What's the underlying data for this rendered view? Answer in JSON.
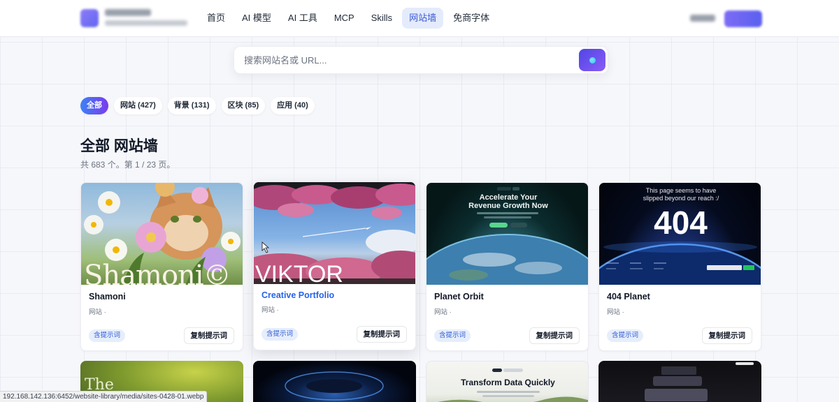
{
  "nav": {
    "items": [
      {
        "label": "首页"
      },
      {
        "label": "AI 模型"
      },
      {
        "label": "AI 工具"
      },
      {
        "label": "MCP"
      },
      {
        "label": "Skills"
      },
      {
        "label": "网站墙",
        "active": true
      },
      {
        "label": "免商字体"
      }
    ]
  },
  "search": {
    "placeholder": "搜索网站名或 URL..."
  },
  "filters": [
    {
      "label": "全部",
      "active": true
    },
    {
      "label": "网站 (427)"
    },
    {
      "label": "背景 (131)"
    },
    {
      "label": "区块 (85)"
    },
    {
      "label": "应用 (40)"
    }
  ],
  "page": {
    "title": "全部 网站墙",
    "subtitle": "共 683 个。第 1 / 23 页。"
  },
  "cards": [
    {
      "title": "Shamoni",
      "meta": "网站 ·",
      "tag": "含提示词",
      "copy": "复制提示词",
      "thumb_text": "Shamoni©"
    },
    {
      "title": "Creative Portfolio",
      "meta": "网站 ·",
      "tag": "含提示词",
      "copy": "复制提示词",
      "thumb_text": "VIKTOR"
    },
    {
      "title": "Planet Orbit",
      "meta": "网站 ·",
      "tag": "含提示词",
      "copy": "复制提示词",
      "thumb_text": "Accelerate Your Revenue Growth Now"
    },
    {
      "title": "404 Planet",
      "meta": "网站 ·",
      "tag": "含提示词",
      "copy": "复制提示词",
      "thumb_text": "This page seems to have slipped beyond our reach :/",
      "thumb_number": "404"
    }
  ],
  "row2": [
    {
      "thumb_text": "The"
    },
    {
      "thumb_text": ""
    },
    {
      "thumb_text": "Transform Data Quickly"
    },
    {
      "thumb_text": ""
    }
  ],
  "status_url": "192.168.142.136:6452/website-library/media/sites-0428-01.webp",
  "colors": {
    "accent": "#4f46e5",
    "active_nav_bg": "#e4ebfb",
    "tag_bg": "#e6eefc",
    "tag_text": "#2f5bd3"
  }
}
